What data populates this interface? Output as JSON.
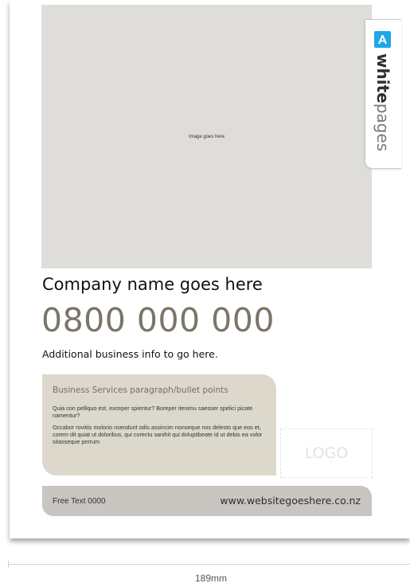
{
  "template": {
    "image_placeholder_text": "Image goes here",
    "company_name": "Company name goes here",
    "phone": "0800 000 000",
    "additional_info": "Additional business info to go here.",
    "services": {
      "title": "Business Services paragraph/bullet points",
      "paragraph_1": "Quia con pelliquo est, exceper spientur? Boreper itenimu saesser spelici picate namentur?",
      "paragraph_2": "Occabor rovitiis molorio nsendunt odis assincim nonseque nos delesto que eos et, corem dit quiat ut doloribus, qui corectu sanihit qui doluptibeate id ut debis ea volor sitasseque perrum"
    },
    "logo_placeholder": "LOGO",
    "footer": {
      "free_text": "Free Text 0000",
      "website": "www.websitegoeshere.co.nz"
    }
  },
  "tab": {
    "brand_bold": "white",
    "brand_light": "pages",
    "icon": "whitepages-logo-icon",
    "icon_color": "#1ea7e8"
  },
  "dimension": {
    "label": "189mm"
  },
  "colors": {
    "image_placeholder": "#dfddd9",
    "phone_text": "#7a7568",
    "services_bg": "#ddd8cc",
    "footer_bg": "#c9c5c1"
  }
}
